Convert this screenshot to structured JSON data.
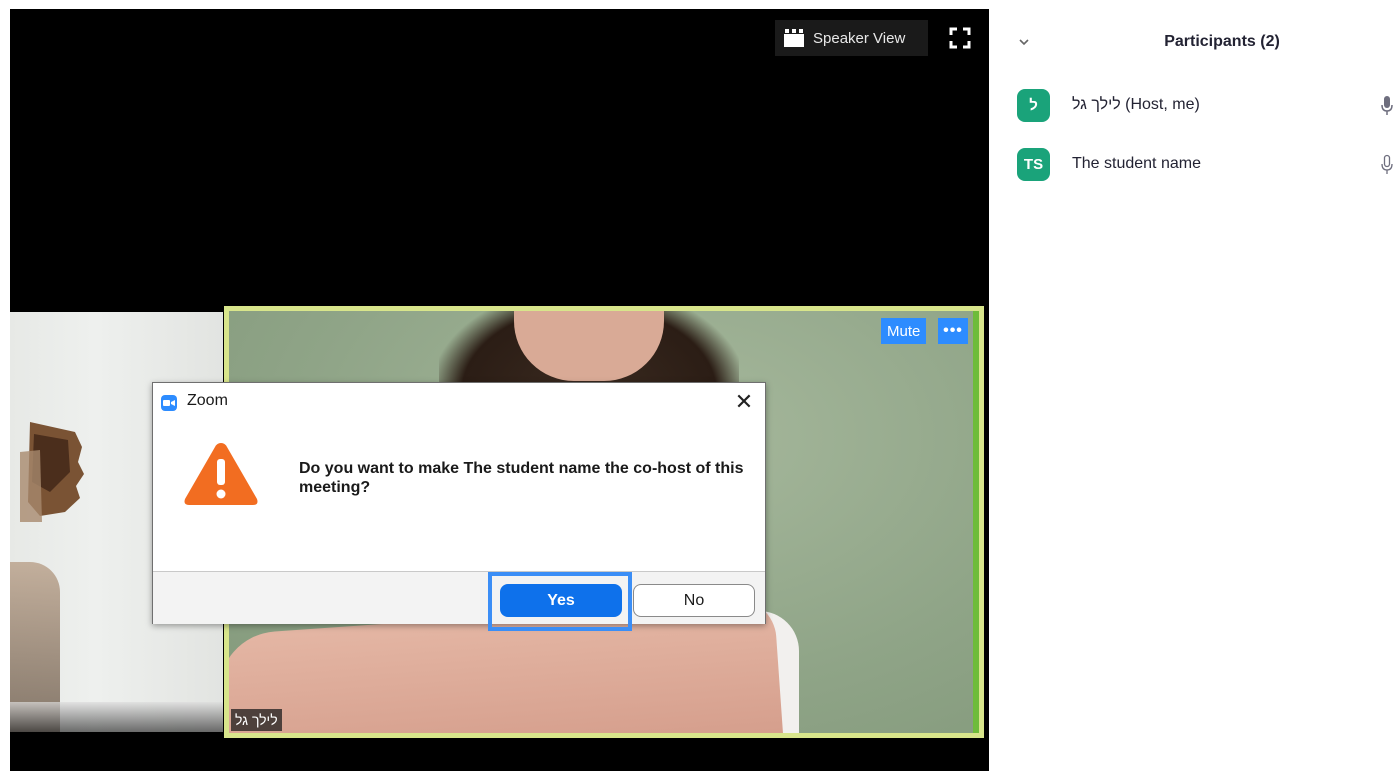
{
  "video": {
    "speaker_view_label": "Speaker View",
    "fullscreen_icon": "fullscreen-icon",
    "main_tile": {
      "mute_label": "Mute",
      "more_label": "•••",
      "name_tag": "לילך גל",
      "border_color": "#d8e58b"
    }
  },
  "dialog": {
    "title": "Zoom",
    "close_label": "✕",
    "message": "Do you want to make The student name the co-host of this meeting?",
    "icon": "warning-icon",
    "yes_label": "Yes",
    "no_label": "No",
    "accent": "#0e71eb",
    "warning_color": "#f26d21"
  },
  "participants": {
    "title": "Participants (2)",
    "items": [
      {
        "initials": "ל",
        "name": "לילך גל (Host, me)",
        "mic": "mic-icon"
      },
      {
        "initials": "TS",
        "name": "The student name",
        "mic": "mic-icon"
      }
    ],
    "avatar_color": "#1aa37a"
  }
}
